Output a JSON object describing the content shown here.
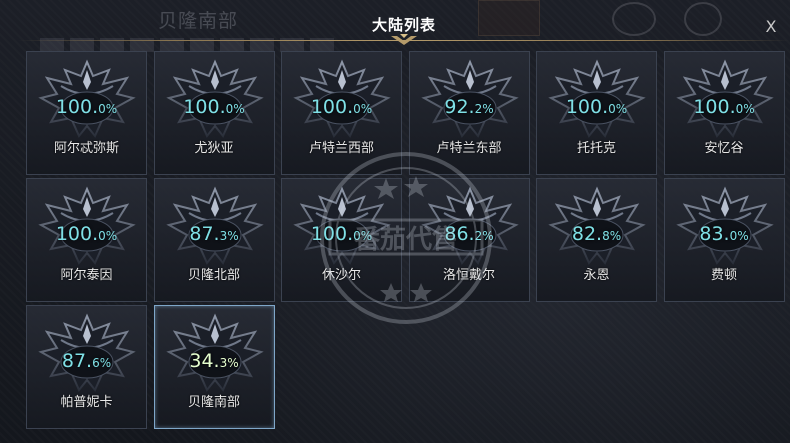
{
  "dialog": {
    "title": "大陆列表",
    "close_label": "X",
    "background_title": "贝隆南部"
  },
  "continents": [
    {
      "name": "阿尔忒弥斯",
      "pct_int": "100.",
      "pct_dec": "0%",
      "selected": false
    },
    {
      "name": "尤狄亚",
      "pct_int": "100.",
      "pct_dec": "0%",
      "selected": false
    },
    {
      "name": "卢特兰西部",
      "pct_int": "100.",
      "pct_dec": "0%",
      "selected": false
    },
    {
      "name": "卢特兰东部",
      "pct_int": "92.",
      "pct_dec": "2%",
      "selected": false
    },
    {
      "name": "托托克",
      "pct_int": "100.",
      "pct_dec": "0%",
      "selected": false
    },
    {
      "name": "安忆谷",
      "pct_int": "100.",
      "pct_dec": "0%",
      "selected": false
    },
    {
      "name": "阿尔泰因",
      "pct_int": "100.",
      "pct_dec": "0%",
      "selected": false
    },
    {
      "name": "贝隆北部",
      "pct_int": "87.",
      "pct_dec": "3%",
      "selected": false
    },
    {
      "name": "休沙尔",
      "pct_int": "100.",
      "pct_dec": "0%",
      "selected": false
    },
    {
      "name": "洛恒戴尔",
      "pct_int": "86.",
      "pct_dec": "2%",
      "selected": false
    },
    {
      "name": "永恩",
      "pct_int": "82.",
      "pct_dec": "8%",
      "selected": false
    },
    {
      "name": "费顿",
      "pct_int": "83.",
      "pct_dec": "0%",
      "selected": false
    },
    {
      "name": "帕普妮卡",
      "pct_int": "87.",
      "pct_dec": "6%",
      "selected": false
    },
    {
      "name": "贝隆南部",
      "pct_int": "34.",
      "pct_dec": "3%",
      "selected": true
    }
  ],
  "watermark_text": "番茄代售",
  "colors": {
    "percent": "#7fe0e6",
    "selected_border": "#7fa7c9",
    "title_gold": "#b59b6a"
  }
}
